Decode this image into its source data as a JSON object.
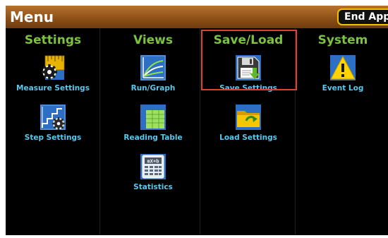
{
  "header": {
    "title": "Menu",
    "end_app_label": "End App"
  },
  "columns": [
    {
      "header": "Settings",
      "items": [
        {
          "label": "Measure Settings",
          "icon": "measure-settings-icon"
        },
        {
          "label": "Step Settings",
          "icon": "step-settings-icon"
        }
      ]
    },
    {
      "header": "Views",
      "items": [
        {
          "label": "Run/Graph",
          "icon": "run-graph-icon"
        },
        {
          "label": "Reading Table",
          "icon": "reading-table-icon"
        },
        {
          "label": "Statistics",
          "icon": "statistics-icon"
        }
      ]
    },
    {
      "header": "Save/Load",
      "items": [
        {
          "label": "Save Settings",
          "icon": "save-settings-icon",
          "selected": true
        },
        {
          "label": "Load Settings",
          "icon": "load-settings-icon"
        }
      ]
    },
    {
      "header": "System",
      "items": [
        {
          "label": "Event Log",
          "icon": "event-log-icon"
        }
      ]
    }
  ],
  "colors": {
    "header_bar": "#8a4e16",
    "column_header": "#7cc242",
    "item_label": "#5cc7ec",
    "end_app_border": "#f2c200",
    "selection_border": "#e04030",
    "background": "#000000"
  }
}
